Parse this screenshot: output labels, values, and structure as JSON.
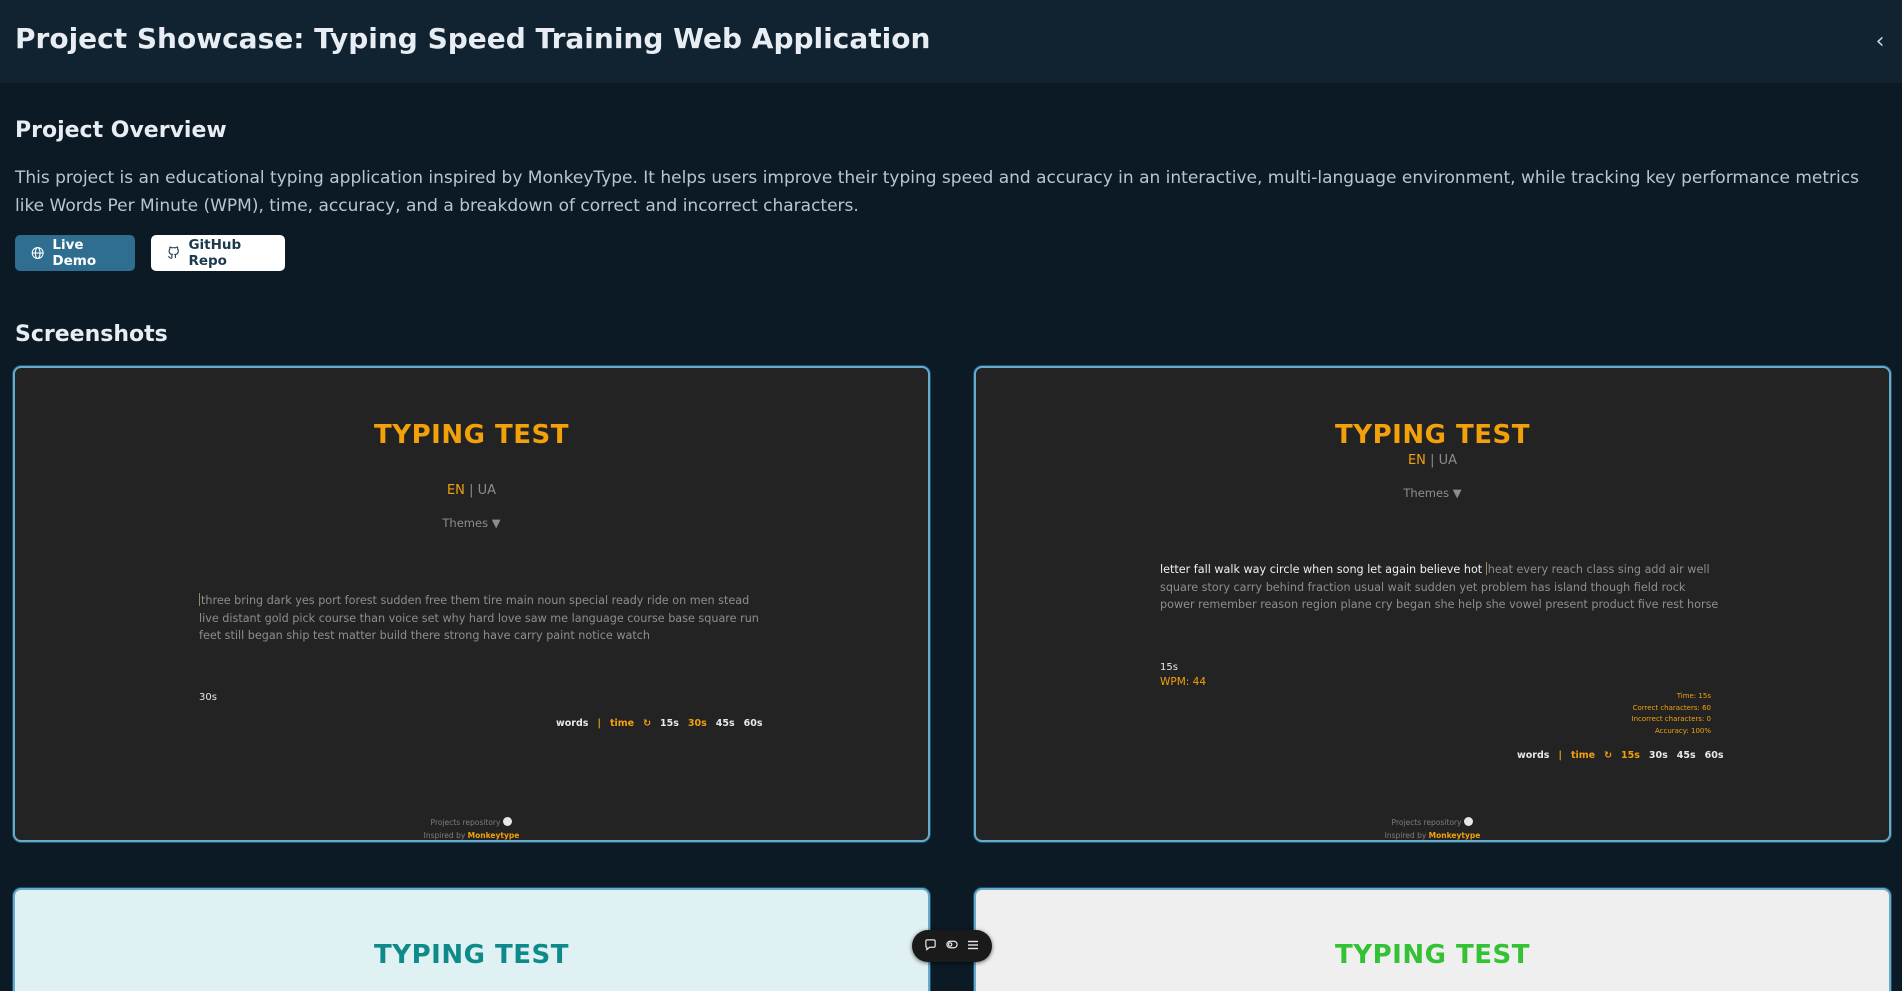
{
  "header": {
    "title": "Project Showcase: Typing Speed Training Web Application"
  },
  "overview": {
    "heading": "Project Overview",
    "description": "This project is an educational typing application inspired by MonkeyType. It helps users improve their typing speed and accuracy in an interactive, multi-language environment, while tracking key performance metrics like Words Per Minute (WPM), time, accuracy, and a breakdown of correct and incorrect characters.",
    "demo_label": "Live Demo",
    "repo_label": "GitHub Repo"
  },
  "screenshots": {
    "heading": "Screenshots",
    "items": [
      {
        "title": "TYPING TEST",
        "lang_active": "EN",
        "lang_sep": "|",
        "lang_other": "UA",
        "themes": "Themes ▼",
        "words": "three bring dark yes port forest sudden free them tire main noun special ready ride on men stead live distant gold pick course than voice set why hard love saw me language course base square run feet still began ship test matter build there strong have carry paint notice watch",
        "timer": "30s",
        "modes": [
          "words",
          "|",
          "time",
          "↻",
          "15s",
          "30s",
          "45s",
          "60s"
        ],
        "footer_repo": "Projects repository",
        "footer_inspired": "Inspired by",
        "footer_brand": "Monkeytype"
      },
      {
        "title": "TYPING TEST",
        "lang_active": "EN",
        "lang_sep": "|",
        "lang_other": "UA",
        "themes": "Themes ▼",
        "typed": "letter fall walk way circle when song let again believe hot ",
        "words": "heat every reach class sing add air well square story carry behind fraction usual wait sudden yet problem has island though field rock power remember reason region plane cry began she help she vowel present product five rest horse",
        "timer": "15s",
        "wpm": "WPM: 44",
        "stats": [
          "Time: 15s",
          "Correct characters: 60",
          "Incorrect characters: 0",
          "Accuracy: 100%"
        ],
        "modes": [
          "words",
          "|",
          "time",
          "↻",
          "15s",
          "30s",
          "45s",
          "60s"
        ],
        "footer_repo": "Projects repository",
        "footer_inspired": "Inspired by",
        "footer_brand": "Monkeytype"
      },
      {
        "title": "TYPING TEST",
        "color": "#0e8a8a"
      },
      {
        "title": "TYPING TEST",
        "color": "#33c233"
      }
    ]
  },
  "colors": {
    "accent": "#f2a10b",
    "background": "#0b1a24",
    "header": "#112230",
    "demo_button": "#2f6d91"
  },
  "toolbar": {
    "icons": [
      "comment-icon",
      "toggle-icon",
      "menu-icon"
    ]
  }
}
